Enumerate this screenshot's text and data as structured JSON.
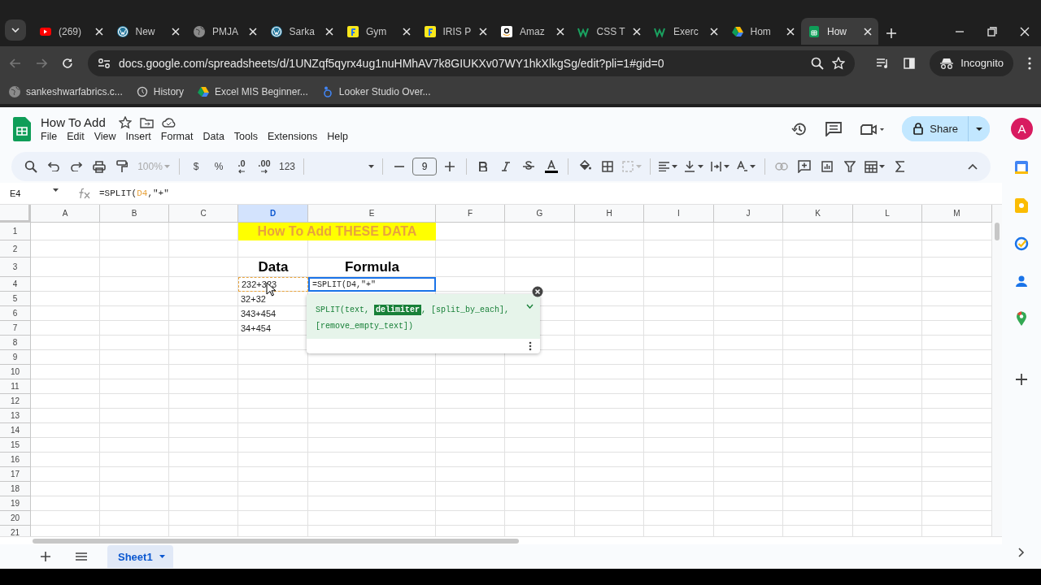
{
  "browser": {
    "tabs": [
      {
        "label": "(269)",
        "selected": false
      },
      {
        "label": "New",
        "selected": false
      },
      {
        "label": "PMJA",
        "selected": false
      },
      {
        "label": "Sarka",
        "selected": false
      },
      {
        "label": "Gym",
        "selected": false
      },
      {
        "label": "IRIS P",
        "selected": false
      },
      {
        "label": "Amaz",
        "selected": false
      },
      {
        "label": "CSS T",
        "selected": false
      },
      {
        "label": "Exerc",
        "selected": false
      },
      {
        "label": "Hom",
        "selected": false
      },
      {
        "label": "How",
        "selected": true
      }
    ],
    "address": {
      "host": "docs.google.com",
      "path": "/spreadsheets/d/1UNZqf5qyrx4ug1nuHMhAV7k8GIUKXv07WY1hkXlkgSg/edit?pli=1#gid=0"
    },
    "profile": "Incognito",
    "bookmarks": [
      "sankeshwarfabrics.c...",
      "History",
      "Excel MIS Beginner...",
      "Looker Studio Over..."
    ]
  },
  "sheets": {
    "title": "How To Add",
    "menu": [
      "File",
      "Edit",
      "View",
      "Insert",
      "Format",
      "Data",
      "Tools",
      "Extensions",
      "Help"
    ],
    "share": "Share",
    "avatar": "A",
    "toolbar": {
      "zoom": "100%",
      "currency": "$",
      "percent": "%",
      "decrease_decimal": ".0",
      "increase_decimal": ".00",
      "number_format": "123",
      "font_size": "9"
    },
    "formula_bar": {
      "cell": "E4",
      "formula": [
        {
          "text": "=SPLIT(",
          "kind": "plain"
        },
        {
          "text": "D4",
          "kind": "ref"
        },
        {
          "text": ",\"+\"",
          "kind": "plain"
        }
      ]
    },
    "columns": [
      {
        "label": "A",
        "selected": false
      },
      {
        "label": "B",
        "selected": false
      },
      {
        "label": "C",
        "selected": false
      },
      {
        "label": "D",
        "selected": true
      },
      {
        "label": "E",
        "selected": false
      },
      {
        "label": "F",
        "selected": false
      },
      {
        "label": "G",
        "selected": false
      },
      {
        "label": "H",
        "selected": false
      },
      {
        "label": "I",
        "selected": false
      },
      {
        "label": "J",
        "selected": false
      },
      {
        "label": "K",
        "selected": false
      },
      {
        "label": "L",
        "selected": false
      },
      {
        "label": "M",
        "selected": false
      }
    ],
    "rows": [
      "1",
      "2",
      "3",
      "4",
      "5",
      "6",
      "7",
      "8",
      "9",
      "10",
      "11",
      "12",
      "13",
      "14",
      "15",
      "16",
      "17",
      "18",
      "19",
      "20",
      "21"
    ],
    "cells": [
      {
        "text": "How To Add THESE DATA",
        "kind": "banner"
      },
      {
        "text": "Data",
        "kind": "heading"
      },
      {
        "text": "Formula",
        "kind": "heading"
      },
      {
        "text": "232+323",
        "kind": "referenced"
      },
      {
        "text": "=SPLIT(D4,\"+\"",
        "kind": "editing"
      },
      {
        "text": "32+32",
        "kind": "value"
      },
      {
        "text": "343+454",
        "kind": "value"
      },
      {
        "text": "34+454",
        "kind": "value"
      }
    ],
    "formula_help": {
      "parts": [
        {
          "text": "SPLIT(text, ",
          "current": false
        },
        {
          "text": "delimiter",
          "current": true
        },
        {
          "text": ", [split_by_each],",
          "current": false
        },
        {
          "text": "[remove_empty_text])",
          "current": false
        }
      ]
    },
    "sheet_tabs": [
      {
        "label": "Sheet1",
        "selected": true
      }
    ]
  }
}
